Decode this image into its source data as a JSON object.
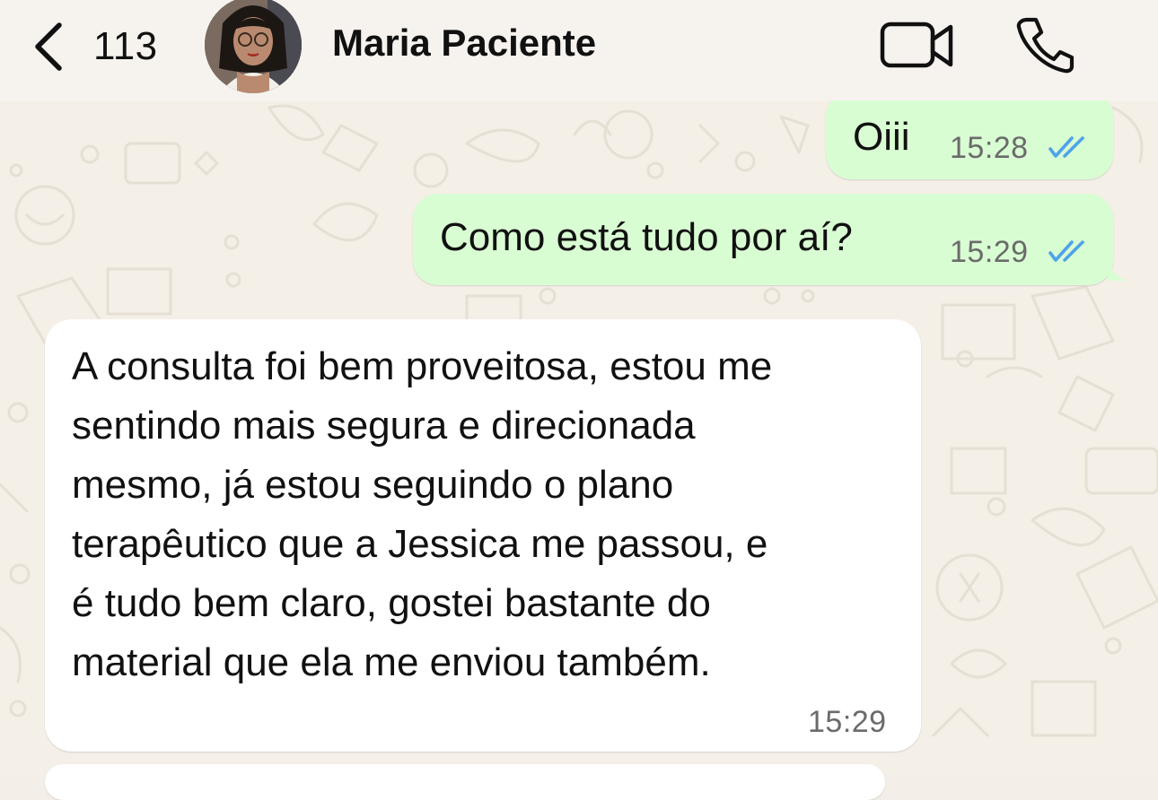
{
  "header": {
    "back_count": "113",
    "contact_name": "Maria Paciente"
  },
  "messages": [
    {
      "direction": "outgoing",
      "text": "Oiii",
      "time": "15:28",
      "status": "read"
    },
    {
      "direction": "outgoing",
      "text": "Como está tudo por aí?",
      "time": "15:29",
      "status": "read"
    },
    {
      "direction": "incoming",
      "lines": [
        "A consulta foi bem proveitosa, estou me",
        "sentindo mais segura e direcionada",
        "mesmo, já estou seguindo o plano",
        "terapêutico que a Jessica me passou, e",
        "é tudo bem claro, gostei bastante do",
        "material que ela me enviou também."
      ],
      "time": "15:29"
    }
  ],
  "colors": {
    "outgoing_bubble": "#d9fdd3",
    "incoming_bubble": "#ffffff",
    "read_ticks": "#4fa3e8",
    "chat_background": "#f4efe7"
  },
  "icons": {
    "back": "chevron-left-icon",
    "video": "video-camera-icon",
    "call": "phone-icon",
    "status": "double-check-icon"
  }
}
